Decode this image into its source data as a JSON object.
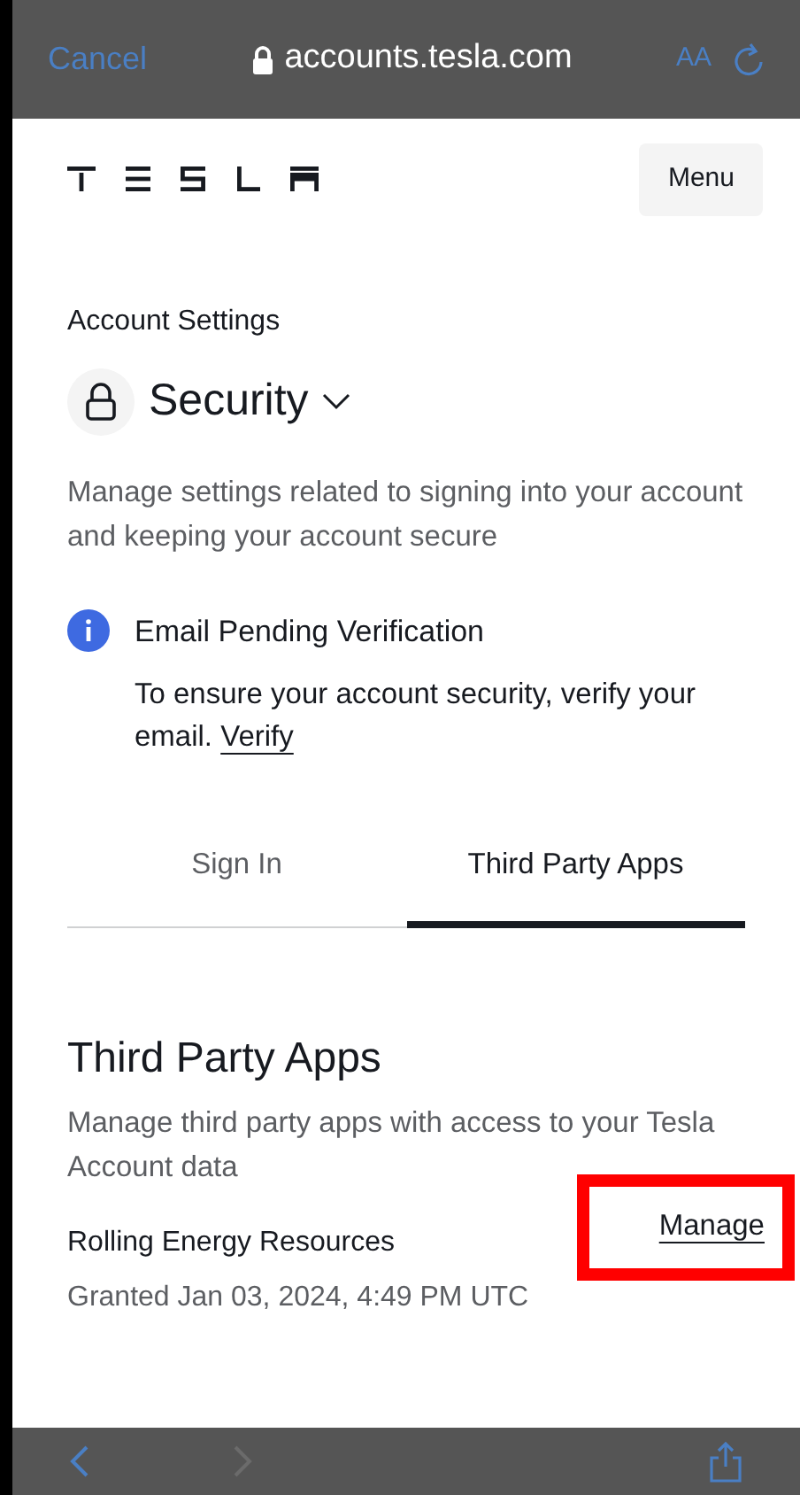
{
  "browser_bar": {
    "cancel": "Cancel",
    "address": "accounts.tesla.com",
    "text_size": "AA"
  },
  "header": {
    "menu": "Menu"
  },
  "account": {
    "label": "Account Settings",
    "section": "Security",
    "description": "Manage settings related to signing into your account and keeping your account secure"
  },
  "notice": {
    "title": "Email Pending Verification",
    "text": "To ensure your account security, verify your email.",
    "link": "Verify"
  },
  "tabs": [
    {
      "label": "Sign In",
      "selected": false
    },
    {
      "label": "Third Party Apps",
      "selected": true
    }
  ],
  "third_party": {
    "title": "Third Party Apps",
    "description": "Manage third party apps with access to your Tesla Account data",
    "apps": [
      {
        "name": "Rolling Energy Resources",
        "granted": "Granted Jan 03, 2024, 4:49 PM UTC",
        "action": "Manage",
        "highlighted": true
      }
    ]
  }
}
